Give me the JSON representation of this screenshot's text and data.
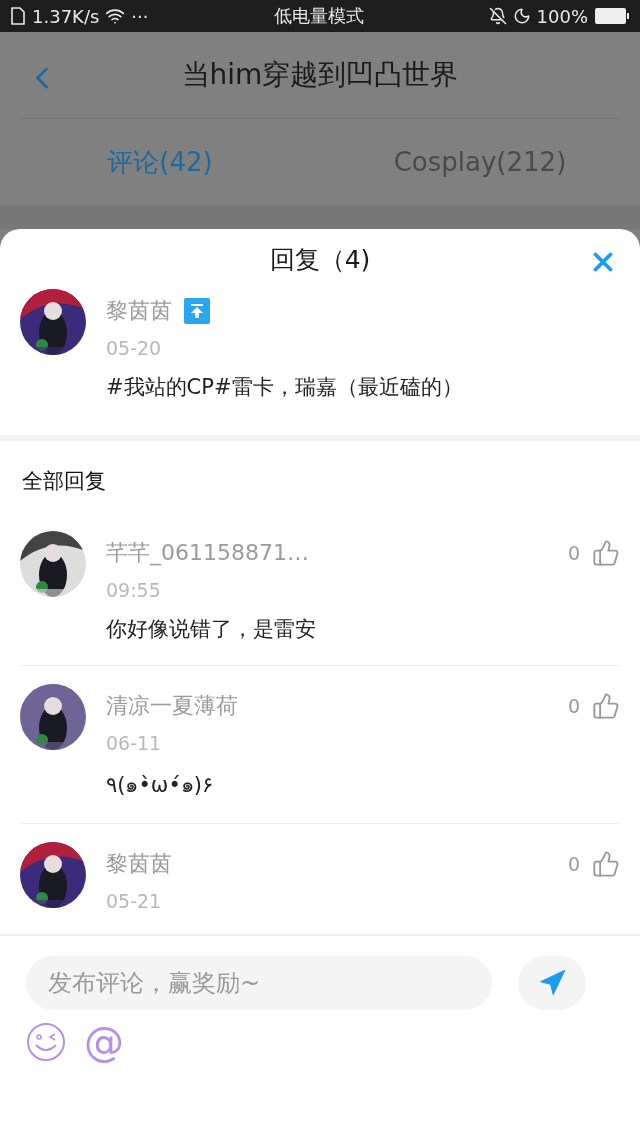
{
  "status_bar": {
    "speed": "1.37K/s",
    "dots": "···",
    "mode": "低电量模式",
    "battery": "100%"
  },
  "nav": {
    "title": "当him穿越到凹凸世界"
  },
  "tabs": [
    {
      "label": "评论(42)",
      "selected": true
    },
    {
      "label": "Cosplay(212)",
      "selected": false
    }
  ],
  "sheet": {
    "title": "回复（4)",
    "main_comment": {
      "user": "黎茵茵",
      "pinned": true,
      "date": "05-20",
      "text": "#我站的CP#雷卡，瑞嘉（最近磕的）"
    },
    "section_title": "全部回复",
    "replies": [
      {
        "user": "芊芊_061158871…",
        "date": "09:55",
        "text": "你好像说错了，是雷安",
        "likes": "0"
      },
      {
        "user": "清凉一夏薄荷",
        "date": "06-11",
        "text": "٩(๑•̀ω•́๑)۶",
        "likes": "0"
      },
      {
        "user": "黎茵茵",
        "date": "05-21",
        "likes": "0"
      }
    ]
  },
  "composer": {
    "placeholder": "发布评论，赢奖励~",
    "at": "@"
  }
}
